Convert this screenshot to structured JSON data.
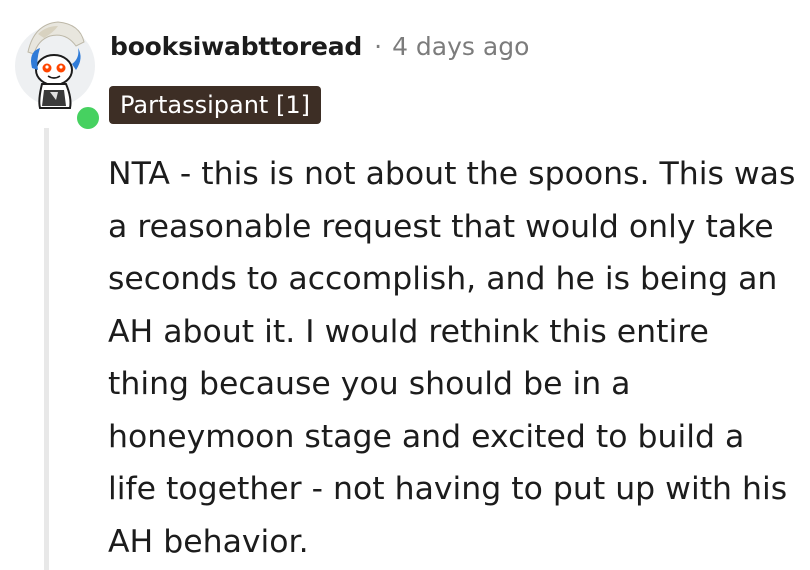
{
  "comment": {
    "author": "booksiwabttoread",
    "separator": "·",
    "timestamp": "4 days ago",
    "flair": "Partassipant [1]",
    "online": true,
    "text": "NTA - this is not about the spoons. This was a reasonable request that would only take seconds to accomplish, and he is being an AH about it. I would rethink this entire thing because you should be in a honeymoon stage and excited to build a life together - not having to put up with his AH behavior."
  },
  "icons": {
    "avatar": "reddit-snoo-avatar-icon",
    "status": "online-status-icon"
  },
  "colors": {
    "flair_bg": "#3d2e25",
    "online": "#46d160",
    "meta_text": "#7c7c7c",
    "thread_line": "#e8e8e8"
  }
}
